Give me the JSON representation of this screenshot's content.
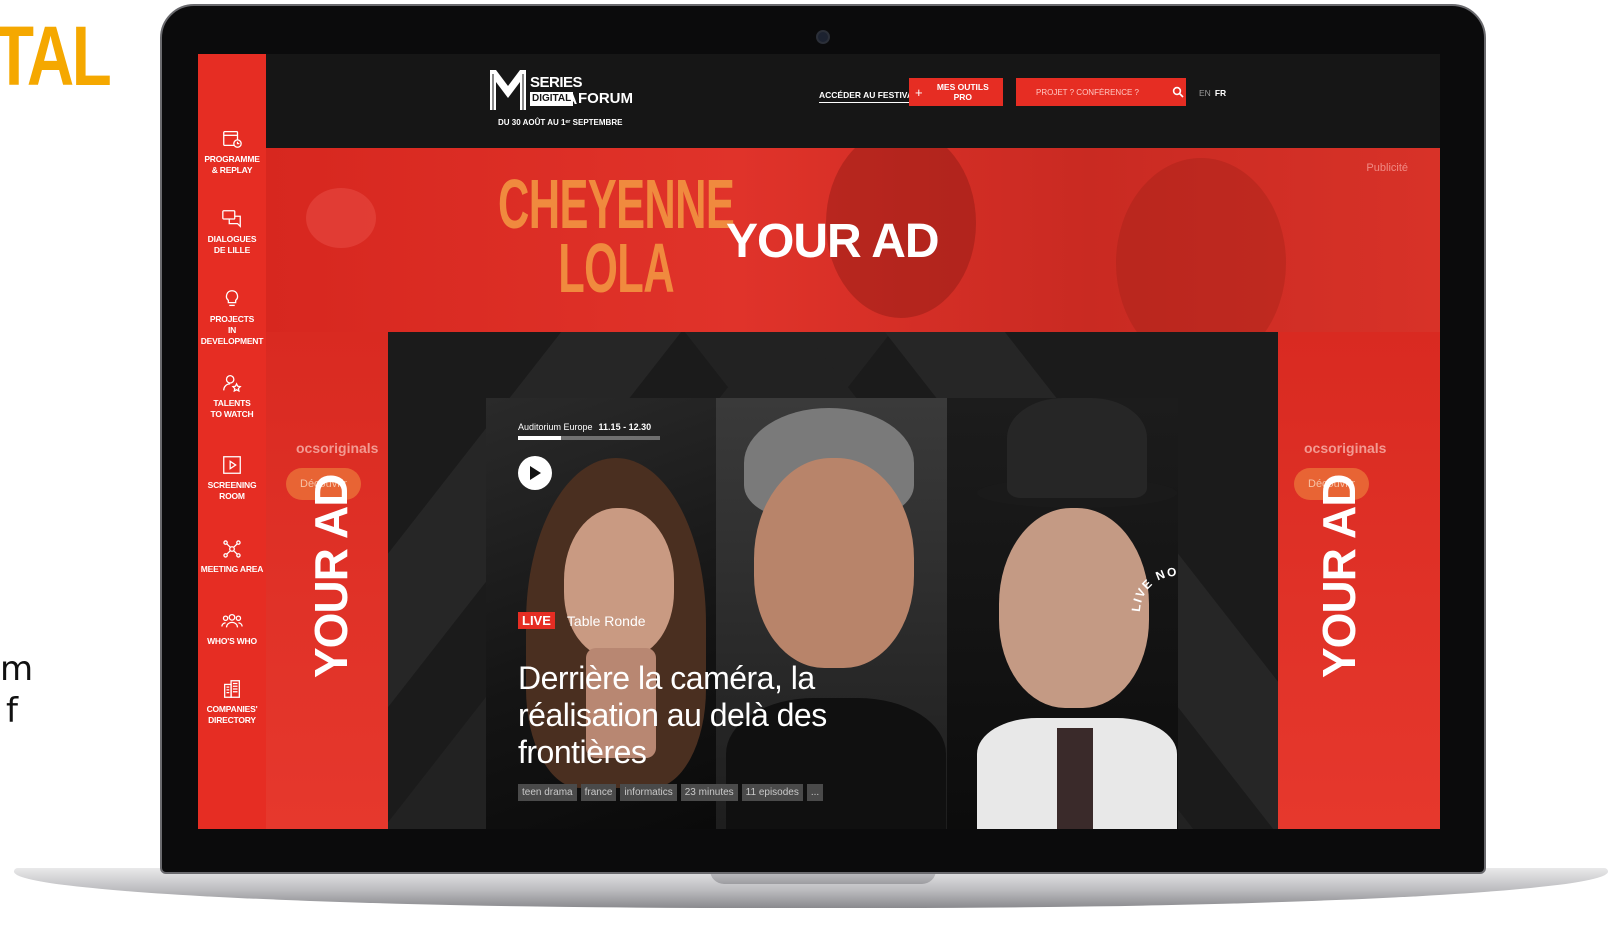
{
  "slide": {
    "title_fragment": "TAL",
    "text_fragment": [
      "m",
      "f"
    ]
  },
  "header": {
    "logo": {
      "line1": "SERIES MANIA",
      "digital": "DIGITAL",
      "forum": "FORUM",
      "dates": "DU 30 AOÛT AU 1ᵉʳ SEPTEMBRE"
    },
    "nav_access": "ACCÉDER AU FESTIVAL",
    "tools_button": "MES OUTILS PRO",
    "search_placeholder": "PROJET ? CONFÉRENCE ?",
    "lang_en": "EN",
    "lang_fr": "FR"
  },
  "sidebar": {
    "items": [
      {
        "label": "PROGRAMME\n& REPLAY",
        "icon": "calendar-icon"
      },
      {
        "label": "DIALOGUES\nDE LILLE",
        "icon": "chat-bubbles-icon"
      },
      {
        "label": "PROJECTS\nIN DEVELOPMENT",
        "icon": "lightbulb-icon"
      },
      {
        "label": "TALENTS\nTO WATCH",
        "icon": "person-star-icon"
      },
      {
        "label": "SCREENING\nROOM",
        "icon": "play-square-icon"
      },
      {
        "label": "MEETING AREA",
        "icon": "network-icon"
      },
      {
        "label": "WHO'S WHO",
        "icon": "people-icon"
      },
      {
        "label": "COMPANIES'\nDIRECTORY",
        "icon": "buildings-icon"
      }
    ]
  },
  "banner": {
    "show_title_1": "CHEYENNE",
    "show_title_2": "LOLA",
    "ad_text": "YOUR AD",
    "label": "Publicité"
  },
  "side_ads": {
    "brand": "ocsoriginals",
    "button": "Découvrir",
    "ad_text": "YOUR AD"
  },
  "player": {
    "room": "Auditorium Europe",
    "time": "11.15 - 12.30",
    "progress": 0.3,
    "live_label": "LIVE",
    "category": "Table Ronde",
    "title": "Derrière la caméra, la réalisation au delà des frontières",
    "tags": [
      "teen drama",
      "france",
      "informatics",
      "23 minutes",
      "11 episodes",
      "..."
    ],
    "live_ring_text": "LIVE NOW LIVE NOW "
  },
  "colors": {
    "accent": "#e62d23",
    "header_bg": "#161616",
    "slide_title": "#f5a800"
  }
}
